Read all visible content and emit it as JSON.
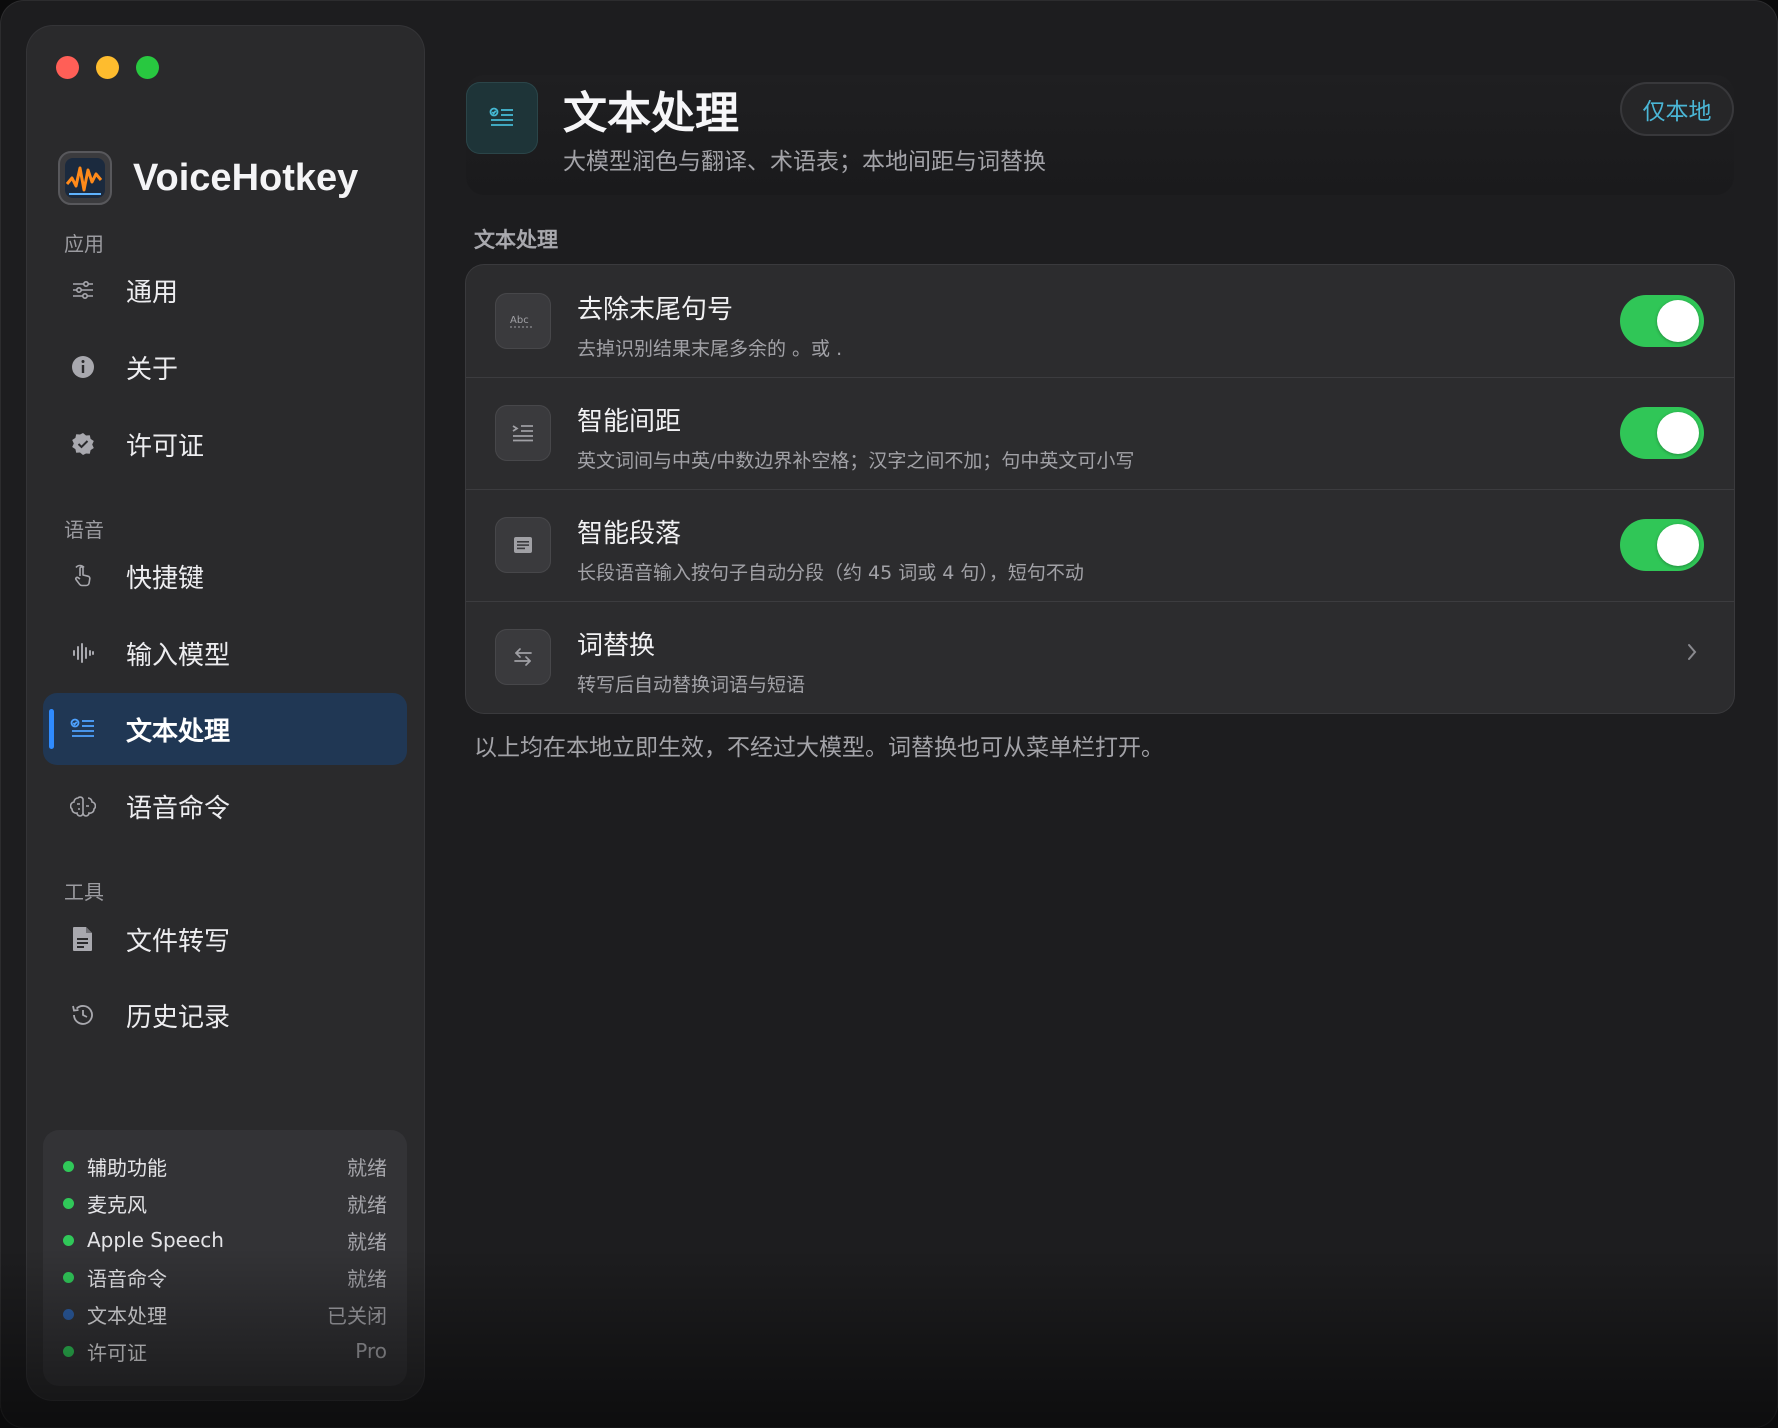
{
  "app": {
    "name": "VoiceHotkey"
  },
  "sidebar": {
    "sections": [
      {
        "label": "应用"
      },
      {
        "label": "语音"
      },
      {
        "label": "工具"
      }
    ],
    "items": [
      {
        "label": "通用",
        "icon": "sliders-icon"
      },
      {
        "label": "关于",
        "icon": "info-icon"
      },
      {
        "label": "许可证",
        "icon": "verified-badge-icon"
      },
      {
        "label": "快捷键",
        "icon": "hand-pointer-icon"
      },
      {
        "label": "输入模型",
        "icon": "waveform-icon"
      },
      {
        "label": "文本处理",
        "icon": "text-checklist-icon",
        "active": true
      },
      {
        "label": "语音命令",
        "icon": "brain-icon"
      },
      {
        "label": "文件转写",
        "icon": "document-icon"
      },
      {
        "label": "历史记录",
        "icon": "history-icon"
      }
    ],
    "status": [
      {
        "name": "辅助功能",
        "value": "就绪",
        "color": "#30c859"
      },
      {
        "name": "麦克风",
        "value": "就绪",
        "color": "#30c859"
      },
      {
        "name": "Apple Speech",
        "value": "就绪",
        "color": "#30c859"
      },
      {
        "name": "语音命令",
        "value": "就绪",
        "color": "#30c859"
      },
      {
        "name": "文本处理",
        "value": "已关闭",
        "color": "#2d5fa6"
      },
      {
        "name": "许可证",
        "value": "Pro",
        "color": "#30c859"
      }
    ]
  },
  "header": {
    "title": "文本处理",
    "subtitle": "大模型润色与翻译、术语表；本地间距与词替换",
    "badge": "仅本地",
    "icon": "text-checklist-icon"
  },
  "group": {
    "label": "文本处理",
    "rows": [
      {
        "title": "去除末尾句号",
        "desc": "去掉识别结果末尾多余的 。或 .",
        "icon": "abc-icon",
        "control": "toggle",
        "on": true
      },
      {
        "title": "智能间距",
        "desc": "英文词间与中英/中数边界补空格；汉字之间不加；句中英文可小写",
        "icon": "text-indent-icon",
        "control": "toggle",
        "on": true
      },
      {
        "title": "智能段落",
        "desc": "长段语音输入按句子自动分段（约 45 词或 4 句），短句不动",
        "icon": "paragraph-icon",
        "control": "toggle",
        "on": true
      },
      {
        "title": "词替换",
        "desc": "转写后自动替换词语与短语",
        "icon": "swap-arrows-icon",
        "control": "chevron"
      }
    ]
  },
  "footnote": "以上均在本地立即生效，不经过大模型。词替换也可从菜单栏打开。",
  "colors": {
    "accent_blue": "#2f8bff",
    "toggle_on": "#30c657",
    "badge_text": "#4ab6d6"
  }
}
